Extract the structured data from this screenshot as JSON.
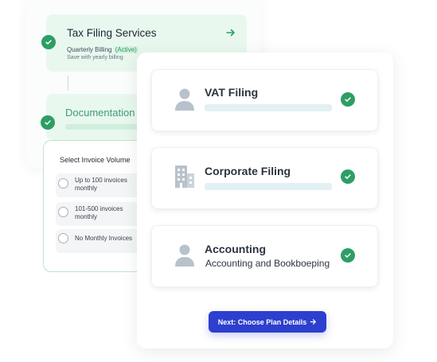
{
  "tax_services": {
    "title": "Tax Filing Services",
    "billing_label": "Quarterly Billing",
    "billing_badge": "(Active)",
    "note": "Save with yearly billing"
  },
  "documentation": {
    "title": "Documentation"
  },
  "invoice": {
    "title": "Select Invoice Volume",
    "options": [
      {
        "label": "Up to 100 invoices monthly"
      },
      {
        "label": "101-500 invoices monthly"
      },
      {
        "label": "No Monthly Invoices"
      }
    ]
  },
  "services": [
    {
      "title": "VAT Filing",
      "icon": "person-icon"
    },
    {
      "title": "Corporate Filing",
      "icon": "building-icon"
    },
    {
      "title": "Accounting",
      "subtitle": "Accounting and Bookboeping",
      "icon": "person-icon"
    }
  ],
  "next_button": {
    "label": "Next: Choose Plan Details"
  },
  "colors": {
    "accent_green": "#2e9e64",
    "card_green": "#e9f8ef",
    "primary_button": "#2d3fce",
    "icon_gray": "#b8c2cc"
  }
}
